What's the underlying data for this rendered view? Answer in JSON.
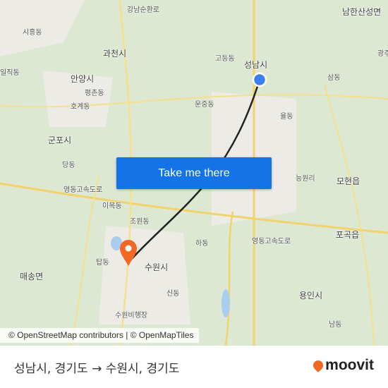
{
  "map": {
    "labels": [
      "강남순환로",
      "남한산성면",
      "시흥동",
      "과천시",
      "고등동",
      "성남시",
      "광주",
      "일직동",
      "삼동",
      "안양시",
      "평촌동",
      "운중동",
      "호계동",
      "율동",
      "군포시",
      "당동",
      "능원리",
      "모현읍",
      "영동고속도로",
      "이목동",
      "조원동",
      "포곡읍",
      "하동",
      "탑동",
      "수원시",
      "매송면",
      "신동",
      "용인시",
      "수원비행장",
      "남동",
      "영동고속도로"
    ],
    "origin_color": "#3d7df0",
    "destination_color": "#f26722",
    "route_color": "#222222"
  },
  "cta": {
    "label": "Take me there"
  },
  "attribution": "© OpenStreetMap contributors | © OpenMapTiles",
  "footer": {
    "origin": "성남시, 경기도",
    "arrow": "→",
    "destination": "수원시, 경기도",
    "logo": "moovit"
  }
}
